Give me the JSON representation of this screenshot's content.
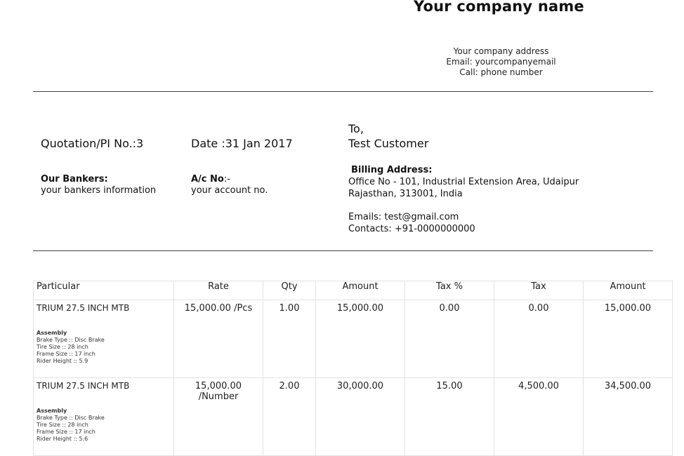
{
  "company": {
    "name": "Your company name",
    "address": "Your company address",
    "email": "Email: yourcompanyemail",
    "phone": "Call: phone number"
  },
  "quotation": {
    "number": "Quotation/PI No.:3",
    "date": "Date :31 Jan 2017"
  },
  "bankers": {
    "label": "Our Bankers:",
    "value": "your bankers information"
  },
  "account": {
    "label": "A/c No",
    "suffix": ":-",
    "value": "your account no."
  },
  "customer": {
    "to": "To,",
    "name": "Test Customer",
    "billing_label": "Billing Address:",
    "address_line1": "Office No - 101, Industrial Extension Area, Udaipur",
    "address_line2": "Rajasthan, 313001, India",
    "emails": "Emails: test@gmail.com",
    "contacts": "Contacts: +91-0000000000"
  },
  "table": {
    "headers": [
      "Particular",
      "Rate",
      "Qty",
      "Amount",
      "Tax %",
      "Tax",
      "Amount"
    ],
    "rows": [
      {
        "name": "TRIUM 27.5 INCH MTB",
        "details_title": "Assembly",
        "details": [
          "Brake Type :: Disc Brake",
          "Tire Size :: 28 inch",
          "Frame Size :: 17 inch",
          "Rider Height :: 5.9"
        ],
        "rate": "15,000.00 /Pcs",
        "qty": "1.00",
        "amount": "15,000.00",
        "tax_percent": "0.00",
        "tax": "0.00",
        "total": "15,000.00"
      },
      {
        "name": "TRIUM 27.5 INCH MTB",
        "details_title": "Assembly",
        "details": [
          "Brake Type :: Disc Brake",
          "Tire Size :: 28 inch",
          "Frame Size :: 17 inch",
          "Rider Height :: 5.6"
        ],
        "rate": "15,000.00 /Number",
        "qty": "2.00",
        "amount": "30,000.00",
        "tax_percent": "15.00",
        "tax": "4,500.00",
        "total": "34,500.00"
      }
    ]
  }
}
